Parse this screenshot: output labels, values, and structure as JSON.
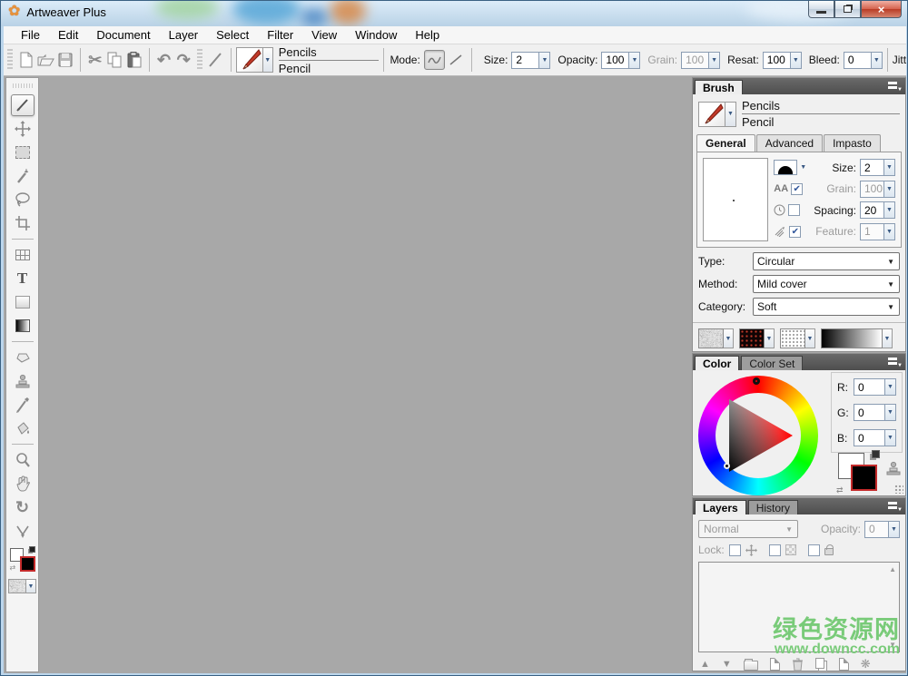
{
  "window": {
    "title": "Artweaver Plus"
  },
  "menu": {
    "items": [
      "File",
      "Edit",
      "Document",
      "Layer",
      "Select",
      "Filter",
      "View",
      "Window",
      "Help"
    ]
  },
  "toolbar": {
    "brush_category": "Pencils",
    "brush_name": "Pencil",
    "mode_label": "Mode:",
    "fields": [
      {
        "label": "Size:",
        "value": "2",
        "enabled": true
      },
      {
        "label": "Opacity:",
        "value": "100",
        "enabled": true
      },
      {
        "label": "Grain:",
        "value": "100",
        "enabled": false
      },
      {
        "label": "Resat:",
        "value": "100",
        "enabled": true
      },
      {
        "label": "Bleed:",
        "value": "0",
        "enabled": true
      }
    ],
    "cutoff_label": "Jitt"
  },
  "brush_panel": {
    "title": "Brush",
    "brush_category": "Pencils",
    "brush_name": "Pencil",
    "tabs": [
      "General",
      "Advanced",
      "Impasto"
    ],
    "fields": [
      {
        "label": "Size:",
        "value": "2"
      },
      {
        "label": "Grain:",
        "value": "100"
      },
      {
        "label": "Spacing:",
        "value": "20"
      },
      {
        "label": "Feature:",
        "value": "1"
      }
    ],
    "type_label": "Type:",
    "type_value": "Circular",
    "method_label": "Method:",
    "method_value": "Mild cover",
    "category_label": "Category:",
    "category_value": "Soft"
  },
  "color_panel": {
    "tabs": [
      "Color",
      "Color Set"
    ],
    "r_label": "R:",
    "r_value": "0",
    "g_label": "G:",
    "g_value": "0",
    "b_label": "B:",
    "b_value": "0",
    "foreground_color": "#ffffff",
    "background_color": "#000000"
  },
  "layers_panel": {
    "tabs": [
      "Layers",
      "History"
    ],
    "blend_mode": "Normal",
    "opacity_label": "Opacity:",
    "opacity_value": "0",
    "lock_label": "Lock:"
  },
  "watermark": {
    "line1": "绿色资源网",
    "line2": "www.downcc.com",
    "color": "#79cb79"
  },
  "icons": {
    "app_flower": "✿",
    "close": "×",
    "cut": "✂",
    "undo": "↶",
    "redo": "↷",
    "pen": "✎",
    "dropdown": "▼",
    "check": "✔",
    "aa_label": "AA",
    "text_tool": "T",
    "rotate": "↻",
    "up_triangle": "▲",
    "down_triangle": "▼",
    "gear": "❋",
    "swap_arrow": "⇄"
  },
  "colors": {
    "canvas": "#a8a8a8",
    "panel_bg": "#f0f0f0",
    "selection_red_border": "#c42b2b",
    "accent_titlebar": "#bcd6ec"
  }
}
